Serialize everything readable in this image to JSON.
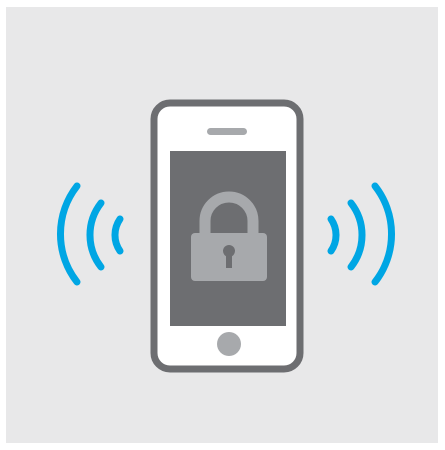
{
  "illustration": {
    "subject": "phone-lock-icon",
    "icons": {
      "phone": "smartphone-icon",
      "lock": "padlock-icon",
      "waves_left": "signal-waves-left-icon",
      "waves_right": "signal-waves-right-icon"
    },
    "colors": {
      "background": "#e8e8e9",
      "phone_body": "#ffffff",
      "phone_outline": "#6d6e71",
      "screen": "#6d6e71",
      "lock": "#a7a9ac",
      "lock_keyhole": "#6d6e71",
      "home_button": "#a7a9ac",
      "speaker": "#a7a9ac",
      "waves": "#00a6e4"
    }
  }
}
